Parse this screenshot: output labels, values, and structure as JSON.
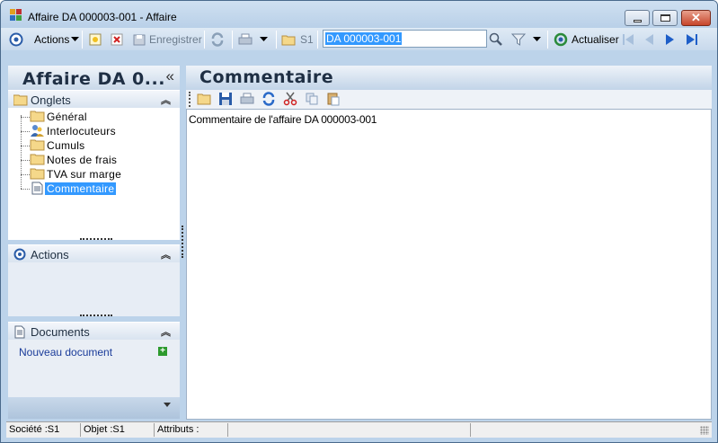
{
  "window": {
    "title": "Affaire DA 000003-001 -  Affaire",
    "close_glyph": "✕"
  },
  "toolbar": {
    "actions_label": "Actions",
    "save_label": "Enregistrer",
    "s1_label": "S1",
    "search_value": "DA 000003-001",
    "refresh_label": "Actualiser"
  },
  "left_panel": {
    "title": "Affaire DA 0...",
    "collapse_glyph": "«",
    "tabs_section": {
      "label": "Onglets",
      "items": [
        {
          "label": "Général",
          "icon": "folder-icon"
        },
        {
          "label": "Interlocuteurs",
          "icon": "people-icon"
        },
        {
          "label": "Cumuls",
          "icon": "folder-icon"
        },
        {
          "label": "Notes de frais",
          "icon": "folder-icon"
        },
        {
          "label": "TVA sur marge",
          "icon": "folder-icon"
        },
        {
          "label": "Commentaire",
          "icon": "document-icon",
          "selected": true
        }
      ]
    },
    "actions_section": {
      "label": "Actions"
    },
    "documents_section": {
      "label": "Documents",
      "new_document": "Nouveau document"
    }
  },
  "right_panel": {
    "title": "Commentaire",
    "content": "Commentaire de l'affaire DA 000003-001"
  },
  "statusbar": {
    "societe": "Société :S1",
    "objet": "Objet :S1",
    "attributs": "Attributs :"
  },
  "colors": {
    "window_bg": "#bcd3ea",
    "selection": "#3399ff",
    "link": "#1b3c9a"
  }
}
